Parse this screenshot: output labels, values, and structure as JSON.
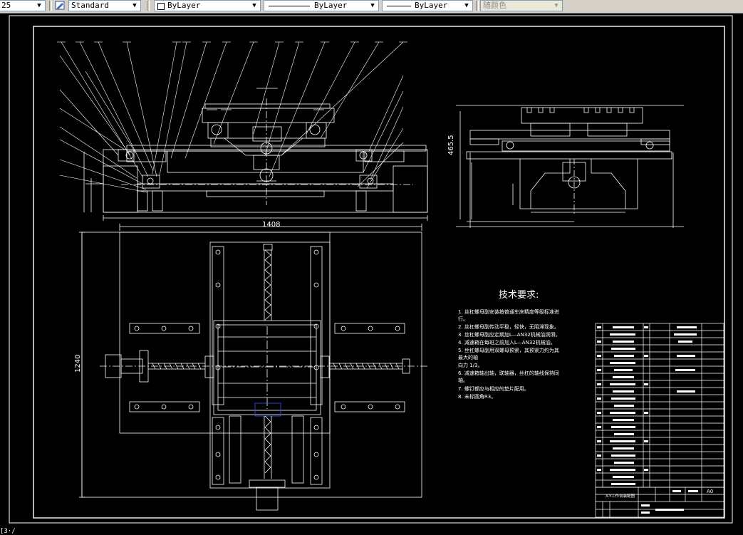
{
  "toolbar": {
    "scale_partial": "25",
    "text_style": "Standard",
    "layer": "ByLayer",
    "linetype": "ByLayer",
    "lineweight": "ByLayer",
    "plot_style": "随颜色"
  },
  "drawing": {
    "dim_top_width": "1408",
    "dim_side_height": "1240",
    "dim_side_view_height": "465.5",
    "tech_title": "技术要求:",
    "tech_notes": [
      "1. 丝杠螺母副安装按普通车床精度等级标准进",
      "行。",
      "2. 丝杠螺母副传动平稳，轻快，无阻滞现象。",
      "3. 丝杠螺母副应定期加L—AN32机械油润滑。",
      "4. 减速箱在每班之前加入L—AN32机械油。",
      "5. 丝杠螺母副用双螺母预紧，其预紧力约为其",
      "最大的轴",
      "   向力 1/3。",
      "6. 减速箱轴出轴，联轴器，丝杠的轴线保持同",
      "轴。",
      "7. 螺钉都应与相应的垫片配用。",
      "8. 未标圆角R3。"
    ],
    "title_block_name": "X-Y工作台装配图",
    "title_block_size": "A0"
  },
  "colors": {
    "background": "#000000",
    "lines": "#ffffff",
    "toolbar": "#d4d0c8",
    "viewport_border": "#ffffff",
    "highlight": "#3355ff"
  },
  "icons": {
    "text_style_icon": "text-style-icon",
    "dropdown": "chevron-down-icon"
  },
  "status_text": "[3·/"
}
